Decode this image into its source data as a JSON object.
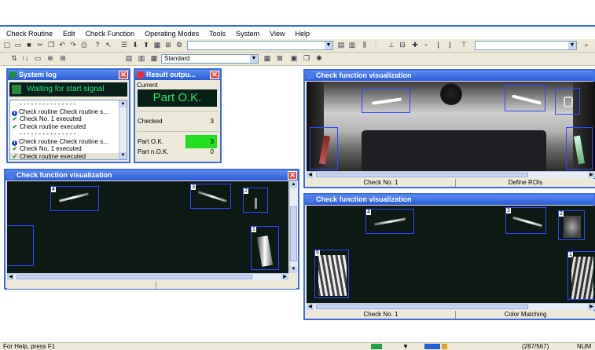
{
  "menu": [
    "Check Routine",
    "Edit",
    "Check Function",
    "Operating Modes",
    "Tools",
    "System",
    "View",
    "Help"
  ],
  "toolbar": {
    "mode_combo": "Standard"
  },
  "syslog": {
    "title": "System log",
    "banner": "Waiting for start signal",
    "entries": [
      {
        "icon": "separator",
        "text": "- - - - - - - - - - - - - - -"
      },
      {
        "icon": "info",
        "text": "Check routine Check routine s..."
      },
      {
        "icon": "check",
        "text": "Check No. 1 executed"
      },
      {
        "icon": "check",
        "text": "Check routine executed"
      },
      {
        "icon": "separator",
        "text": "- - - - - - - - - - - - - - -"
      },
      {
        "icon": "info",
        "text": "Check routine Check routine s..."
      },
      {
        "icon": "check",
        "text": "Check No. 1 executed"
      },
      {
        "icon": "check",
        "text": "Check routine executed"
      }
    ]
  },
  "result": {
    "title": "Result outpu...",
    "current_label": "Current",
    "current_value": "Part O.K.",
    "rows": [
      {
        "label": "Checked",
        "value": "3",
        "highlight": false
      },
      {
        "label": "Part O.K.",
        "value": "3",
        "highlight": true
      },
      {
        "label": "Part n.O.K.",
        "value": "0",
        "highlight": false
      }
    ],
    "highlight_color": "#22dd22"
  },
  "viz_left": {
    "title": "Check function visualization",
    "roi_labels": [
      "4",
      "3",
      "2",
      "1"
    ]
  },
  "viz_top_right": {
    "title": "Check function visualization",
    "status_left": "Check No. 1",
    "status_right": "Define ROIs"
  },
  "viz_bottom_right": {
    "title": "Check function visualization",
    "roi_labels": [
      "4",
      "3",
      "2",
      "1",
      "5"
    ],
    "status_left": "Check No. 1",
    "status_right": "Color Matching"
  },
  "statusbar": {
    "help": "For Help, press F1",
    "coords": "(287/567)",
    "num": "NUM"
  },
  "colors": {
    "title_blue": "#2a5bd6",
    "frame_blue": "#3c6ce0",
    "banner_green": "#29e07a",
    "roi_blue": "#3246ff"
  }
}
